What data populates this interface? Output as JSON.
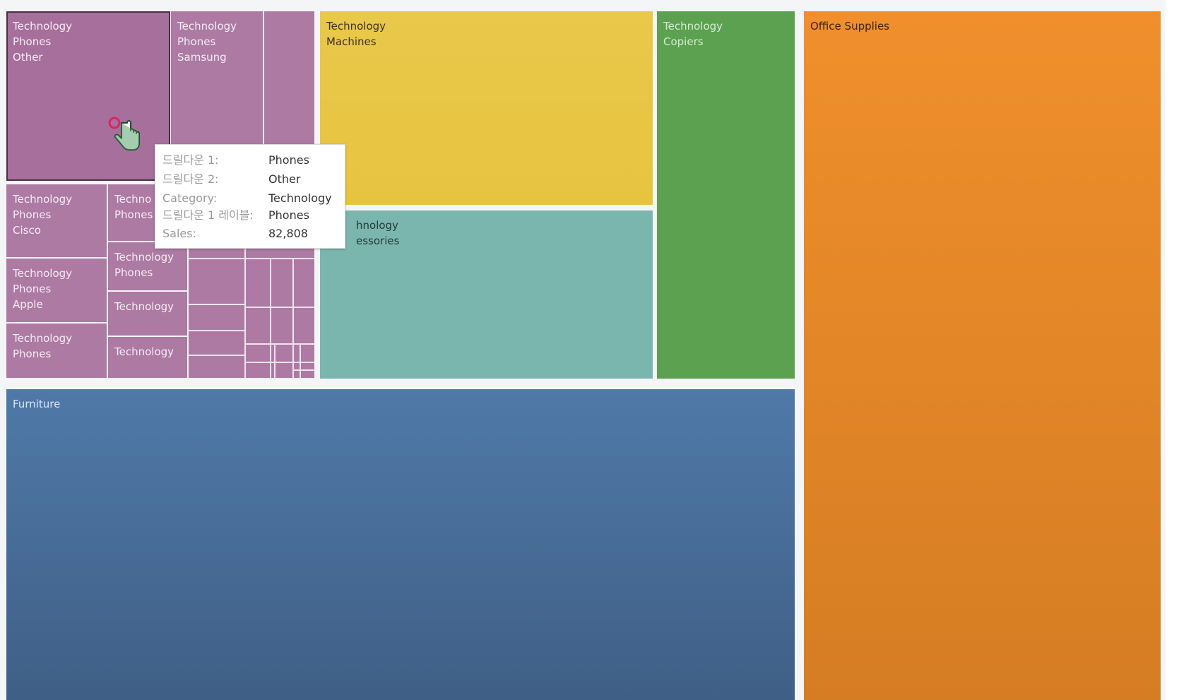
{
  "treemap": {
    "tiles": {
      "phones_other": "Technology\nPhones\nOther",
      "phones_samsung": "Technology\nPhones\nSamsung",
      "phones_cisco": "Technology\nPhones\nCisco",
      "phones_partial": "Techno\nPhones",
      "phones_apple": "Technology\nPhones\nApple",
      "phones_a": "Technology\nPhones",
      "phones_b": "Technology\nPhones",
      "technology_a": "Technology",
      "technology_b": "Technology",
      "machines": "Technology\nMachines",
      "accessories": "hnology\nessories",
      "copiers": "Technology\nCopiers",
      "furniture": "Furniture",
      "office_supplies": "Office Supplies"
    },
    "colors": {
      "technology_phones": "#ad7aa3",
      "technology_machines": "#e8c645",
      "technology_accessories": "#7ab6ae",
      "technology_copiers": "#5ba14f",
      "furniture": "#4a6f9a",
      "office_supplies": "#ec8a2a"
    }
  },
  "tooltip": {
    "rows": [
      {
        "key": "드릴다운 1:",
        "value": "Phones"
      },
      {
        "key": "드릴다운 2:",
        "value": "Other"
      },
      {
        "key": "Category:",
        "value": "Technology"
      },
      {
        "key": "드릴다운 1 레이블:",
        "value": "Phones"
      },
      {
        "key": "Sales:",
        "value": "82,808"
      }
    ]
  }
}
